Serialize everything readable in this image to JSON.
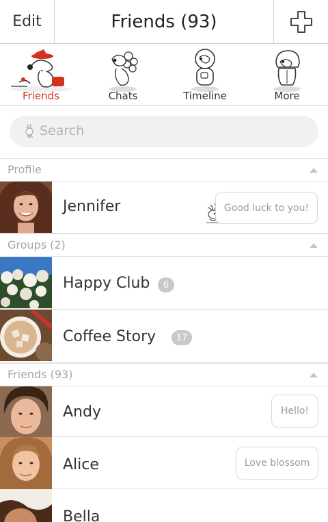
{
  "header": {
    "edit_label": "Edit",
    "title": "Friends (93)",
    "add_icon": "plus-icon"
  },
  "tabs": [
    {
      "label": "Friends",
      "active": true,
      "icon": "snoopy-hat-icon"
    },
    {
      "label": "Chats",
      "icon": "snoopy-flowers-icon"
    },
    {
      "label": "Timeline",
      "icon": "snoopy-astronaut-icon"
    },
    {
      "label": "More",
      "icon": "snoopy-raincoat-icon"
    }
  ],
  "search": {
    "placeholder": "Search",
    "icon": "woodstock-icon"
  },
  "sections": {
    "profile": "Profile",
    "groups": "Groups (2)",
    "friends": "Friends (93)"
  },
  "profile": {
    "name": "Jennifer",
    "status": "Good luck to you!"
  },
  "groups": [
    {
      "name": "Happy Club",
      "count": "6"
    },
    {
      "name": "Coffee Story",
      "count": "17"
    }
  ],
  "friends": [
    {
      "name": "Andy",
      "status": "Hello!"
    },
    {
      "name": "Alice",
      "status": "Love blossom"
    },
    {
      "name": "Bella"
    }
  ],
  "colors": {
    "accent": "#d4301f",
    "divider": "#cfcfcf",
    "badge": "#c9c9c9"
  }
}
